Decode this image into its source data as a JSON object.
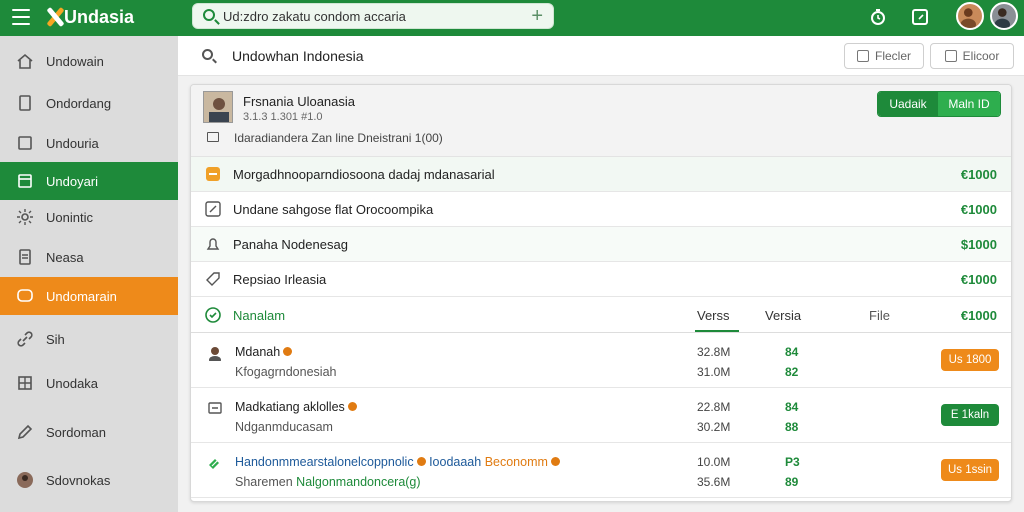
{
  "app": {
    "name": "Undasia"
  },
  "topbar": {
    "search_value": "Ud:zdro zakatu condom accaria"
  },
  "sidebar": {
    "items": [
      {
        "label": "Undowain"
      },
      {
        "label": "Ondordang"
      },
      {
        "label": "Undouria"
      },
      {
        "label": "Undoyari"
      },
      {
        "label": "Uonintic"
      },
      {
        "label": "Neasa"
      },
      {
        "label": "Undomarain"
      },
      {
        "label": "Sih"
      },
      {
        "label": "Unodaka"
      },
      {
        "label": "Sordoman"
      },
      {
        "label": "Sdovnokas"
      }
    ]
  },
  "search_row": {
    "title": "Undowhan Indonesia",
    "btn_filter": "Flecler",
    "btn_export": "Elicoor"
  },
  "card": {
    "head": {
      "name": "Frsnania Uloanasia",
      "sub": "3.1.3 1.301 #1.0",
      "line": "Idaradiandera Zan line Dneistrani 1(00)",
      "seg_a": "Uadaik",
      "seg_b": "Maln ID"
    },
    "rows": [
      {
        "label": "Morgadhnooparndiosoona dadaj mdanasarial",
        "amount": "€1000"
      },
      {
        "label": "Undane sahgose flat Orocoompika",
        "amount": "€1000"
      },
      {
        "label": "Panaha Nodenesag",
        "amount": "$1000"
      },
      {
        "label": "Repsiao Irleasia",
        "amount": "€1000"
      }
    ],
    "table": {
      "section_label": "Nanalam",
      "col_versions": "Verss",
      "col_versia": "Versia",
      "col_file": "File",
      "amount": "€1000"
    },
    "items": [
      {
        "title": "Mdanah",
        "sub": "Kfogagrndonesiah",
        "c1a": "32.8M",
        "c1b": "31.0M",
        "c2a": "84",
        "c2b": "82",
        "badge": "Us 1800",
        "badge_color": "#ee8a1a"
      },
      {
        "title": "Madkatiang aklolles",
        "sub": "Ndganmducasam",
        "c1a": "22.8M",
        "c1b": "30.2M",
        "c2a": "84",
        "c2b": "88",
        "badge": "E 1kaln",
        "badge_color": "#1e8a3a"
      },
      {
        "title_a": "Handonmmearstalonelcoppnolic",
        "title_b": "Ioodaaah",
        "title_c": "Beconomm",
        "sub_a": "Sharemen",
        "sub_b": "Nalgonmandoncera(g)",
        "c1a": "10.0M",
        "c1b": "35.6M",
        "c2a": "P3",
        "c2b": "89",
        "badge": "Us 1ssin",
        "badge_color": "#ee8a1a"
      }
    ]
  },
  "colors": {
    "brand_green": "#1e8a3a",
    "accent_orange": "#ee8a1a",
    "sidebar_bg": "#dcdcdc"
  }
}
